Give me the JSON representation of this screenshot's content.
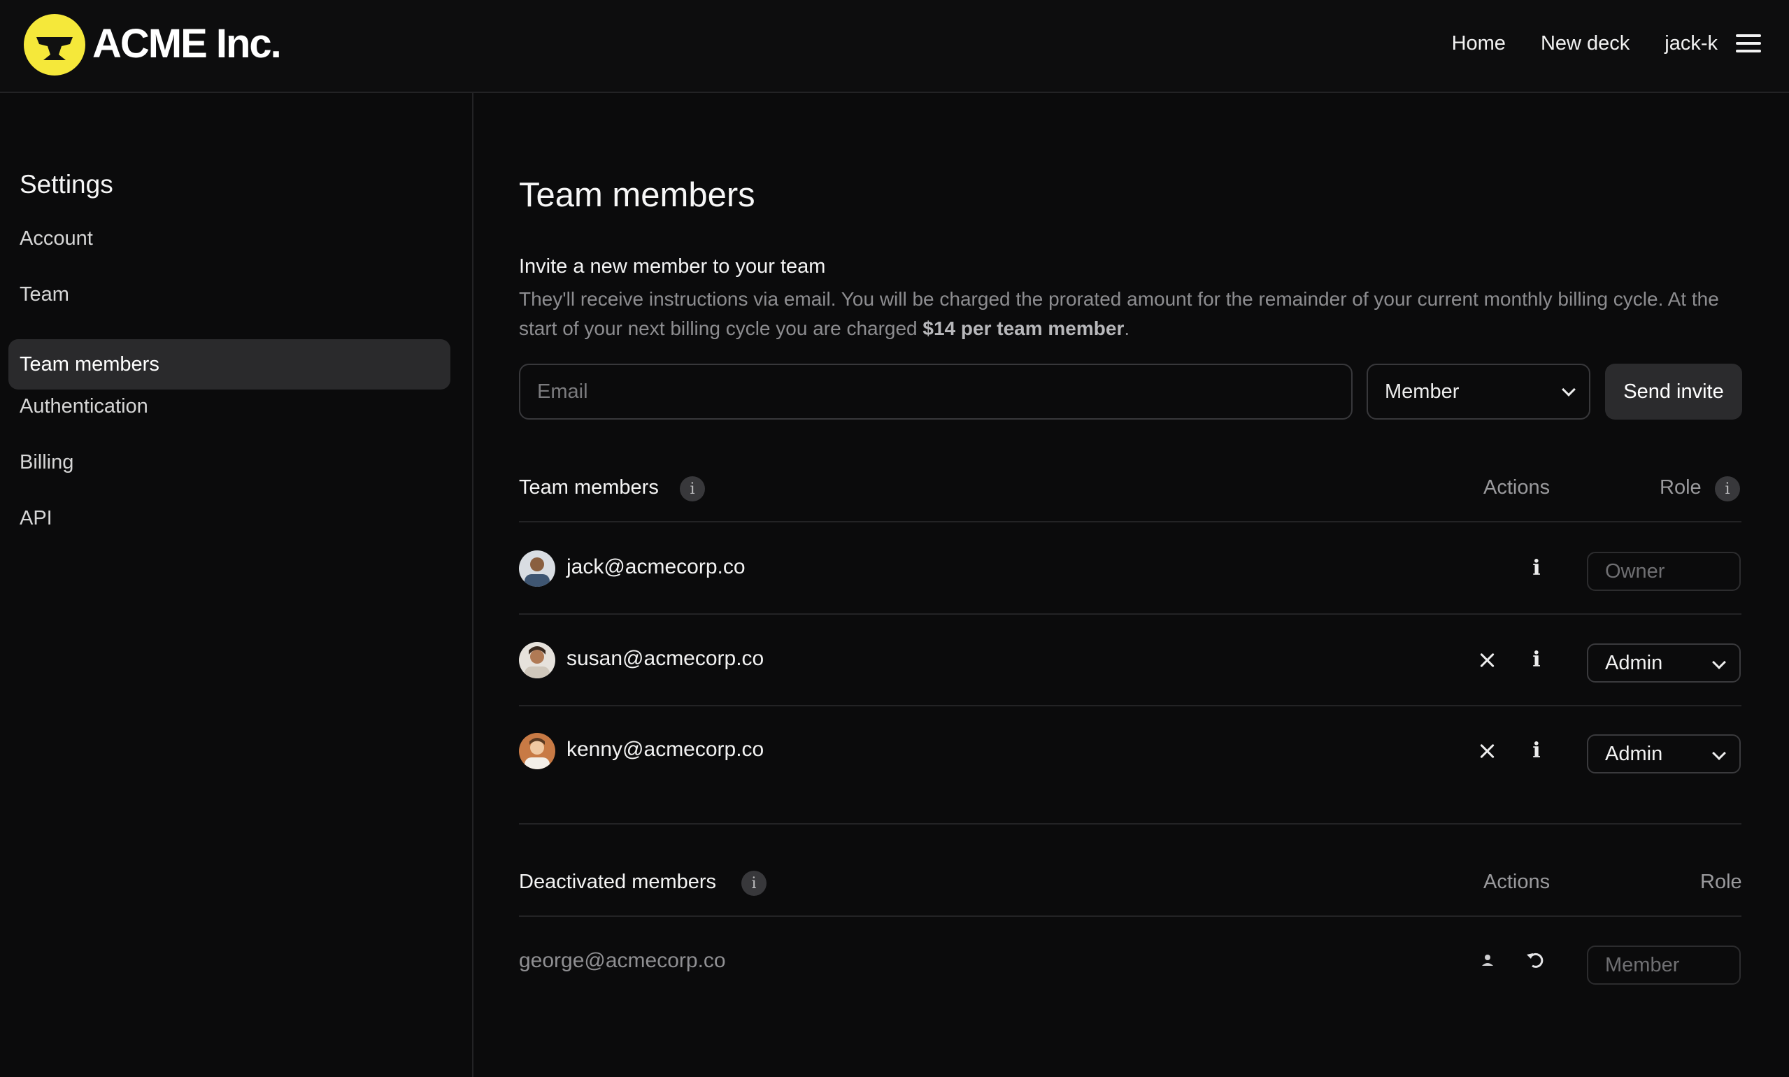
{
  "brand": {
    "name": "ACME Inc.",
    "logo_color": "#f5e83a"
  },
  "topnav": {
    "links": [
      "Home",
      "New deck"
    ],
    "user": "jack-k"
  },
  "sidebar": {
    "title": "Settings",
    "items": [
      {
        "label": "Account",
        "active": false
      },
      {
        "label": "Team",
        "active": false
      },
      {
        "label": "Team members",
        "active": true
      },
      {
        "label": "Authentication",
        "active": false
      },
      {
        "label": "Billing",
        "active": false
      },
      {
        "label": "API",
        "active": false
      }
    ]
  },
  "main": {
    "title": "Team members",
    "invite": {
      "heading": "Invite a new member to your team",
      "description": "They'll receive instructions via email. You will be charged the prorated amount for the remainder of your current monthly billing cycle. At the start of your next billing cycle you are charged",
      "price_highlight": "$14 per team member",
      "description_end": ".",
      "email_placeholder": "Email",
      "role_value": "Member",
      "send_label": "Send invite"
    },
    "team_members": {
      "title": "Team members",
      "info_glyph": "i",
      "col_actions": "Actions",
      "col_role": "Role",
      "rows": [
        {
          "email": "jack@acmecorp.co",
          "role": "Owner",
          "role_editable": false,
          "removable": false,
          "avatar_color": "#5b6f86"
        },
        {
          "email": "susan@acmecorp.co",
          "role": "Admin",
          "role_editable": true,
          "removable": true,
          "avatar_color": "#b48a6a"
        },
        {
          "email": "kenny@acmecorp.co",
          "role": "Admin",
          "role_editable": true,
          "removable": true,
          "avatar_color": "#c87a45"
        }
      ]
    },
    "deactivated_members": {
      "title": "Deactivated members",
      "info_glyph": "i",
      "col_actions": "Actions",
      "col_role": "Role",
      "rows": [
        {
          "email": "george@acmecorp.co",
          "role": "Member"
        }
      ]
    }
  },
  "colors": {
    "background": "#0b0b0c",
    "surface_active": "#2a2a2c",
    "border": "#232325",
    "text_muted": "#8d8d90"
  }
}
